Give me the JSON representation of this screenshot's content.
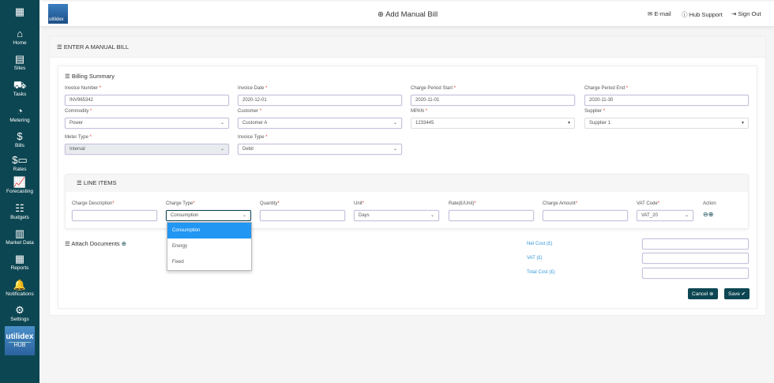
{
  "sidebar": {
    "items": [
      {
        "icon": "home-icon",
        "glyph": "⌂",
        "label": "Home"
      },
      {
        "icon": "sites-icon",
        "glyph": "▤",
        "label": "Sites"
      },
      {
        "icon": "tasks-icon",
        "glyph": "⛟",
        "label": "Tasks"
      },
      {
        "icon": "metering-icon",
        "glyph": "◔",
        "label": "Metering"
      },
      {
        "icon": "bills-icon",
        "glyph": "$",
        "label": "Bills"
      },
      {
        "icon": "rates-icon",
        "glyph": "$▭",
        "label": "Rates"
      },
      {
        "icon": "forecasting-icon",
        "glyph": "📈",
        "label": "Forecasting"
      },
      {
        "icon": "budgets-icon",
        "glyph": "☷",
        "label": "Budgets"
      },
      {
        "icon": "market-data-icon",
        "glyph": "▥",
        "label": "Market Data"
      },
      {
        "icon": "reports-icon",
        "glyph": "▦",
        "label": "Reports"
      },
      {
        "icon": "notifications-icon",
        "glyph": "🔔",
        "label": "Notifications"
      },
      {
        "icon": "settings-icon",
        "glyph": "⚙",
        "label": "Settings"
      }
    ],
    "hub_logo": {
      "brand": "utilidex",
      "sub": "HUB"
    }
  },
  "header": {
    "logo": "utilidex",
    "title": "Add Manual Bill",
    "email": "E-mail",
    "support": "Hub Support",
    "signout": "Sign Out"
  },
  "card": {
    "title": "ENTER A MANUAL BILL"
  },
  "billing": {
    "title": "Billing Summary",
    "fields": [
      {
        "label": "Invoice Number",
        "value": "INV965342",
        "type": "text"
      },
      {
        "label": "Invoice Date",
        "value": "2020-12-01",
        "type": "text"
      },
      {
        "label": "Charge Period Start",
        "value": "2020-11-01",
        "type": "text"
      },
      {
        "label": "Charge Period End",
        "value": "2020-11-30",
        "type": "text"
      },
      {
        "label": "Commodity",
        "value": "Power",
        "type": "select"
      },
      {
        "label": "Customer",
        "value": "Customer A",
        "type": "select"
      },
      {
        "label": "MPAN",
        "value": "1233445",
        "type": "select2"
      },
      {
        "label": "Supplier",
        "value": "Supplier 1",
        "type": "select2"
      },
      {
        "label": "Meter Type",
        "value": "Interval",
        "type": "disabled"
      },
      {
        "label": "Invoice Type",
        "value": "Debit",
        "type": "select"
      }
    ]
  },
  "line_items": {
    "title": "LINE ITEMS",
    "columns": [
      {
        "label": "Charge Description",
        "value": "",
        "type": "text"
      },
      {
        "label": "Charge Type",
        "value": "Consumption",
        "type": "select"
      },
      {
        "label": "Quantity",
        "value": "",
        "type": "text"
      },
      {
        "label": "Unit",
        "value": "Days",
        "type": "select"
      },
      {
        "label": "Rate(£/Unit)",
        "value": "",
        "type": "text"
      },
      {
        "label": "Charge Amount",
        "value": "",
        "type": "text"
      },
      {
        "label": "VAT Code",
        "value": "VAT_20",
        "type": "select"
      }
    ],
    "action_label": "Action",
    "dropdown_options": [
      "Consumption",
      "Energy",
      "Fixed"
    ]
  },
  "attach": {
    "title": "Attach Documents"
  },
  "totals": {
    "net": "Net Cost (£)",
    "vat": "VAT (£)",
    "total": "Total Cost (£)"
  },
  "buttons": {
    "cancel": "Cancel",
    "save": "Save"
  }
}
